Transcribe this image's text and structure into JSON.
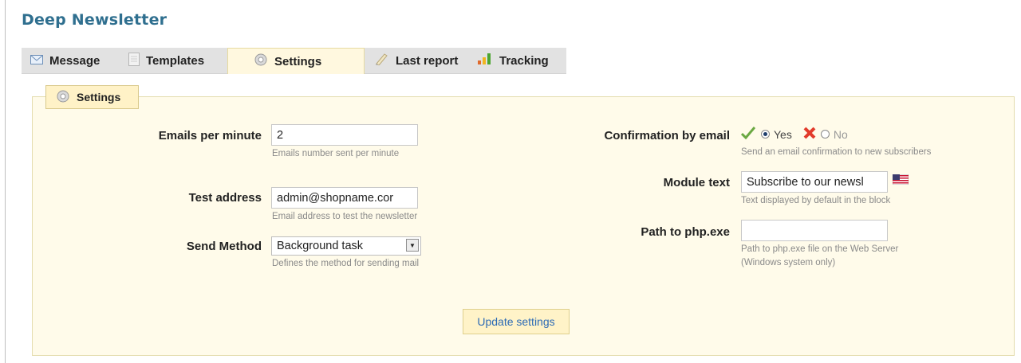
{
  "page_title": "Deep Newsletter",
  "tabs": [
    {
      "label": "Message",
      "icon": "envelope-icon"
    },
    {
      "label": "Templates",
      "icon": "document-icon"
    },
    {
      "label": "Settings",
      "icon": "gear-icon",
      "active": true
    },
    {
      "label": "Last report",
      "icon": "pencil-icon"
    },
    {
      "label": "Tracking",
      "icon": "bar-chart-icon"
    }
  ],
  "fieldset": {
    "legend": "Settings"
  },
  "fields": {
    "emails_per_minute": {
      "label": "Emails per minute",
      "value": "2",
      "hint": "Emails number sent per minute"
    },
    "test_address": {
      "label": "Test address",
      "value": "admin@shopname.cor",
      "hint": "Email address to test the newsletter"
    },
    "send_method": {
      "label": "Send Method",
      "value": "Background task",
      "hint": "Defines the method for sending mail"
    },
    "confirmation": {
      "label": "Confirmation by email",
      "yes": "Yes",
      "no": "No",
      "selected": "Yes",
      "hint": "Send an email confirmation to new subscribers"
    },
    "module_text": {
      "label": "Module text",
      "value": "Subscribe to our newsl",
      "hint": "Text displayed by default in the block",
      "flag": "us-flag-icon"
    },
    "php_path": {
      "label": "Path to php.exe",
      "value": "",
      "hint_line1": "Path to php.exe file on the Web Server",
      "hint_line2": "(Windows system only)"
    }
  },
  "update_button": "Update settings",
  "colors": {
    "title": "#2f6f8f",
    "panel_bg": "#fffbea",
    "button_text": "#2d6bb5"
  }
}
